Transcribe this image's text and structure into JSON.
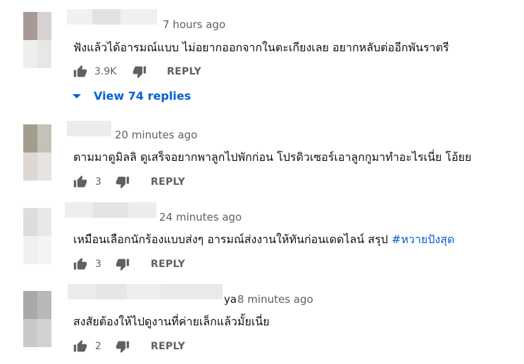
{
  "comments": [
    {
      "time": "7 hours ago",
      "text": "ฟังแล้วได้อารมณ์แบบ ไม่อยากออกจากในตะเกียงเลย อยากหลับต่ออีกพันราตรี",
      "likes": "3.9K",
      "reply_label": "REPLY",
      "view_replies": "View 74 replies"
    },
    {
      "time": "20 minutes ago",
      "text": "ตามมาดูมิลลิ ดูเสร็จอยากพาลูกไปพักก่อน โปรดิวเซอร์เอาลูกกูมาทำอะไรเนี่ย โอ้ยย",
      "likes": "3",
      "reply_label": "REPLY"
    },
    {
      "time": "24 minutes ago",
      "text": "เหมือนเลือกนักร้องแบบส่งๆ อารมณ์ส่งงานให้ทันก่อนเดดไลน์ สรุป ",
      "hashtag": "#หวายปังสุด",
      "likes": "3",
      "reply_label": "REPLY"
    },
    {
      "name_suffix": "ya",
      "time": "8 minutes ago",
      "text": "สงสัยต้องให้ไปดูงานที่ค่ายเล็กแล้วมั้ยเนี่ย",
      "likes": "2",
      "reply_label": "REPLY"
    }
  ],
  "colors": {
    "link": "#065fd4",
    "meta": "#606060",
    "text": "#0f0f0f"
  },
  "icons": {
    "like": "thumbs-up-icon",
    "dislike": "thumbs-down-icon",
    "expand": "caret-down-icon"
  }
}
